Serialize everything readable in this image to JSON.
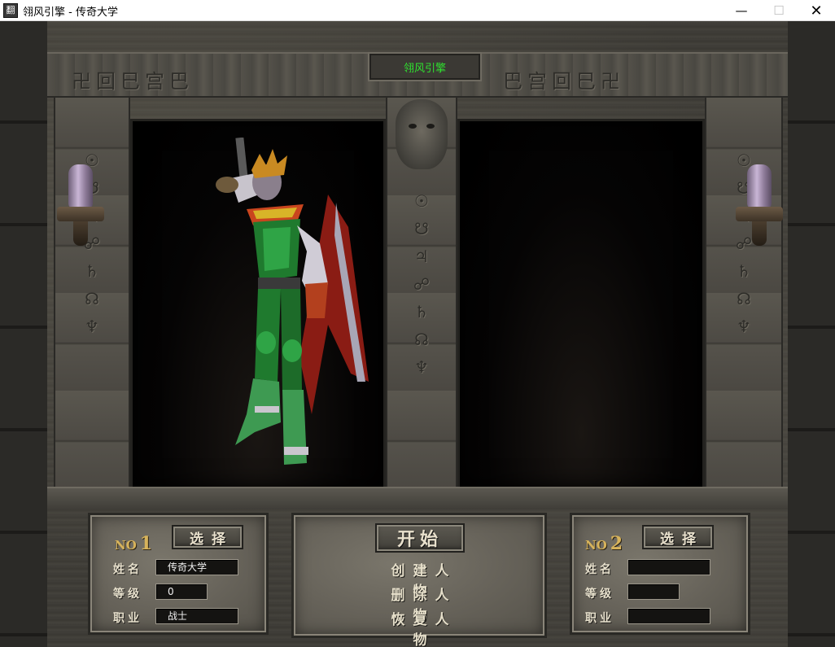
{
  "window": {
    "title": "翎风引擎 - 传奇大学",
    "icon_text": "翻",
    "min_glyph": "—",
    "max_glyph": "☐",
    "close_glyph": "✕"
  },
  "scene": {
    "plaque_title": "翎风引擎",
    "frieze_glyphs_left": "卍回巳宫巴",
    "frieze_glyphs_right": "巴宫回巳卍",
    "rune_column": "☉\n☋\n♃\n☍\n♄\n☊\n♆"
  },
  "slot1": {
    "no_text": "NO",
    "no_number": "1",
    "select_label": "选择",
    "name_label": "姓名",
    "name_value": "传奇大学",
    "level_label": "等级",
    "level_value": "0",
    "job_label": "职业",
    "job_value": "战士"
  },
  "slot2": {
    "no_text": "NO",
    "no_number": "2",
    "select_label": "选择",
    "name_label": "姓名",
    "name_value": "",
    "level_label": "等级",
    "level_value": "",
    "job_label": "职业",
    "job_value": ""
  },
  "center": {
    "start_label": "开始",
    "create_label": "创建人物",
    "delete_label": "删除人物",
    "restore_label": "恢复人物"
  },
  "colors": {
    "plaque_text": "#2fe22f",
    "no_label": "#d7b35b",
    "stone": "#67635a"
  }
}
